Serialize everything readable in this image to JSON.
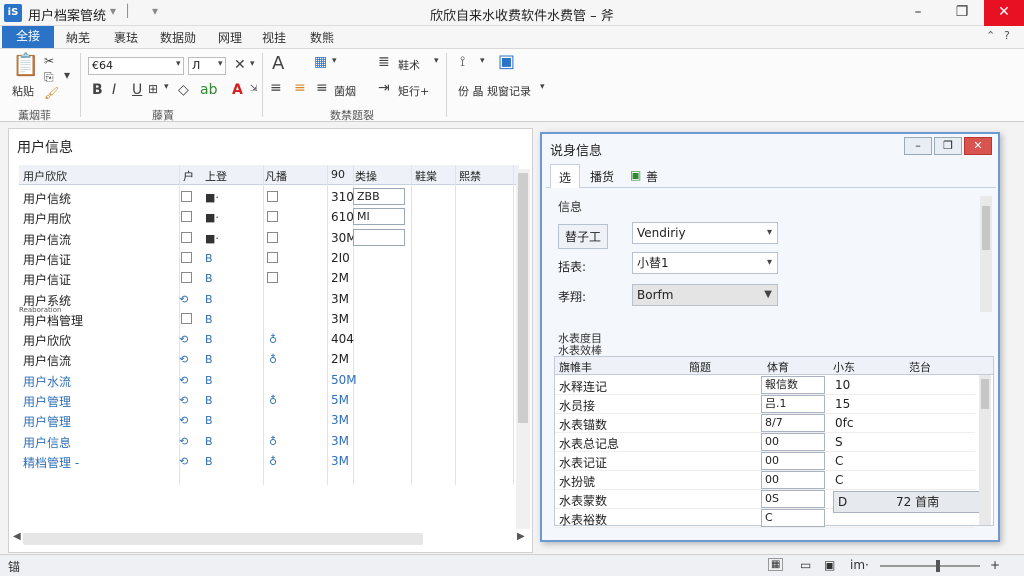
{
  "titlebar": {
    "app_icon": "iS",
    "doc_title": "用户档案管统",
    "window_title": "欣欣自来水收费软件水费管 – 斧",
    "min": "–",
    "max": "❐",
    "close": "✕"
  },
  "tabs": {
    "file": "全接",
    "items": [
      "納芜",
      "裹珐",
      "数据勋",
      "网理",
      "视挂",
      "数熊"
    ]
  },
  "ribbon": {
    "font_name": "€64",
    "font_size": "Л",
    "group_labels": [
      "薰烟菲",
      "藤賣",
      "数禁题裂"
    ],
    "btn_wrap": "鞋术",
    "btn_merge": "菌烟",
    "btn_fold": "矩行+",
    "btn_record": "份 晶 规窗记录"
  },
  "left_panel": {
    "title": "用户信息",
    "headers": [
      "用户欣欣",
      "户",
      "上登",
      "凡播",
      "90",
      "类操",
      "鞋棠",
      "熙禁"
    ],
    "rows": [
      {
        "name": "用户信统",
        "sizeval": "310",
        "input": "ZBB",
        "blue": false
      },
      {
        "name": "用户用欣",
        "sizeval": "610",
        "input": "MI",
        "blue": false
      },
      {
        "name": "用户信流",
        "sizeval": "30M",
        "input": "",
        "blue": false
      },
      {
        "name": "用户信证",
        "sizeval": "2I0",
        "input": "",
        "blue": false
      },
      {
        "name": "用户信证",
        "sizeval": "2M",
        "input": "",
        "blue": false
      },
      {
        "name": "用户系统",
        "sizeval": "3M",
        "input": "",
        "blue": false
      },
      {
        "name": "用户档管理",
        "sizeval": "3M",
        "input": "",
        "blue": false
      },
      {
        "name": "用户欣欣",
        "sizeval": "404",
        "input": "",
        "blue": false
      },
      {
        "name": "用户信流",
        "sizeval": "2M",
        "input": "",
        "blue": false
      },
      {
        "name": "用户水流",
        "sizeval": "50M",
        "input": "",
        "blue": true
      },
      {
        "name": "用户管理",
        "sizeval": "5M",
        "input": "",
        "blue": true
      },
      {
        "name": "用户管理",
        "sizeval": "3M",
        "input": "",
        "blue": true
      },
      {
        "name": "用户信息",
        "sizeval": "3M",
        "input": "",
        "blue": true
      },
      {
        "name": "精档管理 -",
        "sizeval": "3M",
        "input": "",
        "blue": true
      }
    ],
    "tiny_label": "Reaboration"
  },
  "dialog": {
    "title": "说身信息",
    "tabs": [
      "选",
      "播货",
      "善"
    ],
    "section": "信息",
    "fields": [
      {
        "label": "替子工",
        "value": "Vendiriy"
      },
      {
        "label": "括表:",
        "value": "小替1"
      },
      {
        "label": "孝翔:",
        "value": "Borfm"
      }
    ],
    "sub_section_1": "水表度目",
    "sub_section_2": "水表效棒",
    "grid_headers": [
      "旗帷丰",
      "簡题",
      "体育",
      "小东",
      "范台"
    ],
    "grid_rows": [
      {
        "name": "水释连记",
        "c2": "報信数",
        "c3": "10"
      },
      {
        "name": "水员接",
        "c2": "吕.1",
        "c3": "15"
      },
      {
        "name": "水表锚数",
        "c2": "8/7",
        "c3": "0fc"
      },
      {
        "name": "水表总记息",
        "c2": "00",
        "c3": "S"
      },
      {
        "name": "水表记证",
        "c2": "00",
        "c3": "C"
      },
      {
        "name": "水扮號",
        "c2": "00",
        "c3": "C"
      },
      {
        "name": "水表蒙数",
        "c2": "0S",
        "c3": ""
      },
      {
        "name": "水表裕数",
        "c2": "C",
        "c3": ""
      }
    ],
    "action_left": "D",
    "action_right": "72 首南"
  },
  "statusbar": {
    "left": "锚",
    "zoom_label": "im·",
    "plus": "+"
  }
}
